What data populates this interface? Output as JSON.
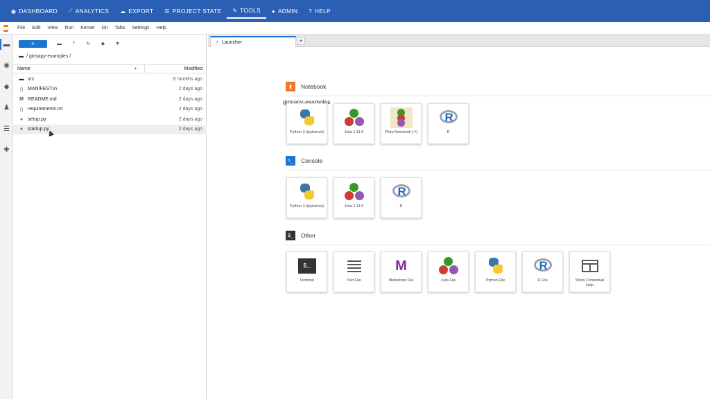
{
  "topnav": {
    "items": [
      {
        "label": "DASHBOARD",
        "icon": "dashboard-icon"
      },
      {
        "label": "ANALYTICS",
        "icon": "chart-icon"
      },
      {
        "label": "EXPORT",
        "icon": "cloud-icon"
      },
      {
        "label": "PROJECT STATE",
        "icon": "server-icon"
      },
      {
        "label": "TOOLS",
        "icon": "wrench-icon"
      },
      {
        "label": "ADMIN",
        "icon": "user-icon"
      },
      {
        "label": "HELP",
        "icon": "question-icon"
      }
    ],
    "active": "TOOLS",
    "color": "#2a5fb4"
  },
  "menubar": [
    "File",
    "Edit",
    "View",
    "Run",
    "Kernel",
    "Git",
    "Tabs",
    "Settings",
    "Help"
  ],
  "browser": {
    "new_label": "+",
    "breadcrumb": "/ ginsapy-examples /",
    "header_name": "Name",
    "header_modified": "Modified",
    "files": [
      {
        "name": "src",
        "modified": "6 months ago",
        "icon": "folder-icon"
      },
      {
        "name": "MANIFEST.in",
        "modified": "2 days ago",
        "icon": "file-icon"
      },
      {
        "name": "README.md",
        "modified": "2 days ago",
        "icon": "markdown-icon"
      },
      {
        "name": "requirements.txt",
        "modified": "2 days ago",
        "icon": "file-icon"
      },
      {
        "name": "setup.py",
        "modified": "2 days ago",
        "icon": "python-icon"
      },
      {
        "name": "startup.py",
        "modified": "2 days ago",
        "icon": "python-icon"
      }
    ],
    "selected": "startup.py"
  },
  "tabs": [
    {
      "label": "Launcher"
    }
  ],
  "launcher": {
    "title": "ginsapy-examples",
    "sections": {
      "notebook": {
        "label": "Notebook",
        "cards": [
          "Python 3 (ipykernel)",
          "Julia 1.11.5",
          "Pluto Notebook [↗]",
          "R"
        ]
      },
      "console": {
        "label": "Console",
        "cards": [
          "Python 3 (ipykernel)",
          "Julia 1.11.5",
          "R"
        ]
      },
      "other": {
        "label": "Other",
        "cards": [
          "Terminal",
          "Text File",
          "Markdown File",
          "Julia File",
          "Python File",
          "R File",
          "Show Contextual Help"
        ]
      }
    }
  }
}
